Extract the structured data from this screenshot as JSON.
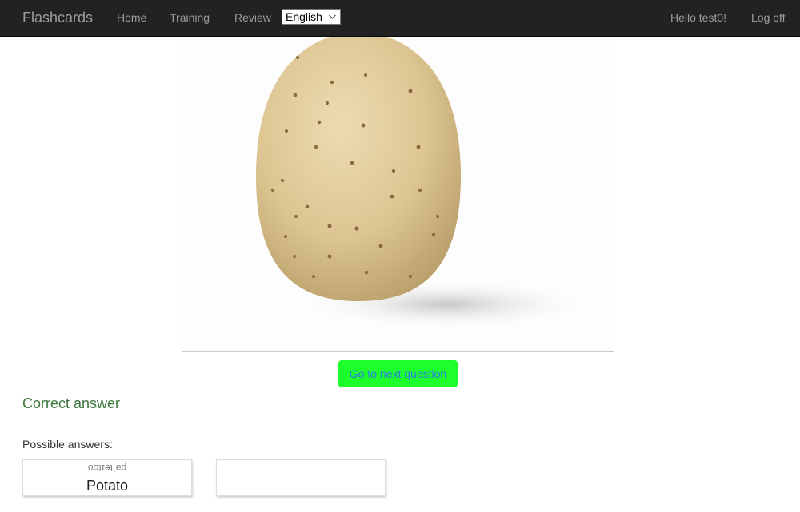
{
  "navbar": {
    "brand": "Flashcards",
    "links": [
      "Home",
      "Training",
      "Review"
    ],
    "language_select": {
      "value": "English",
      "icon": "chevron-down-icon"
    },
    "greeting": "Hello test0!",
    "logoff": "Log off"
  },
  "main": {
    "image_subject": "potato",
    "next_button": "Go to next question",
    "result": "Correct answer",
    "possible_label": "Possible answers:",
    "answers": [
      {
        "phonetic": "pəˈteɪtoʊ",
        "word": "Potato"
      },
      {
        "phonetic": "",
        "word": ""
      }
    ]
  },
  "colors": {
    "navbar_bg": "#222222",
    "nav_text": "#9d9d9d",
    "next_button_bg": "#1dff2a",
    "next_button_text": "#2b7de0",
    "correct_text": "#3c763d"
  }
}
